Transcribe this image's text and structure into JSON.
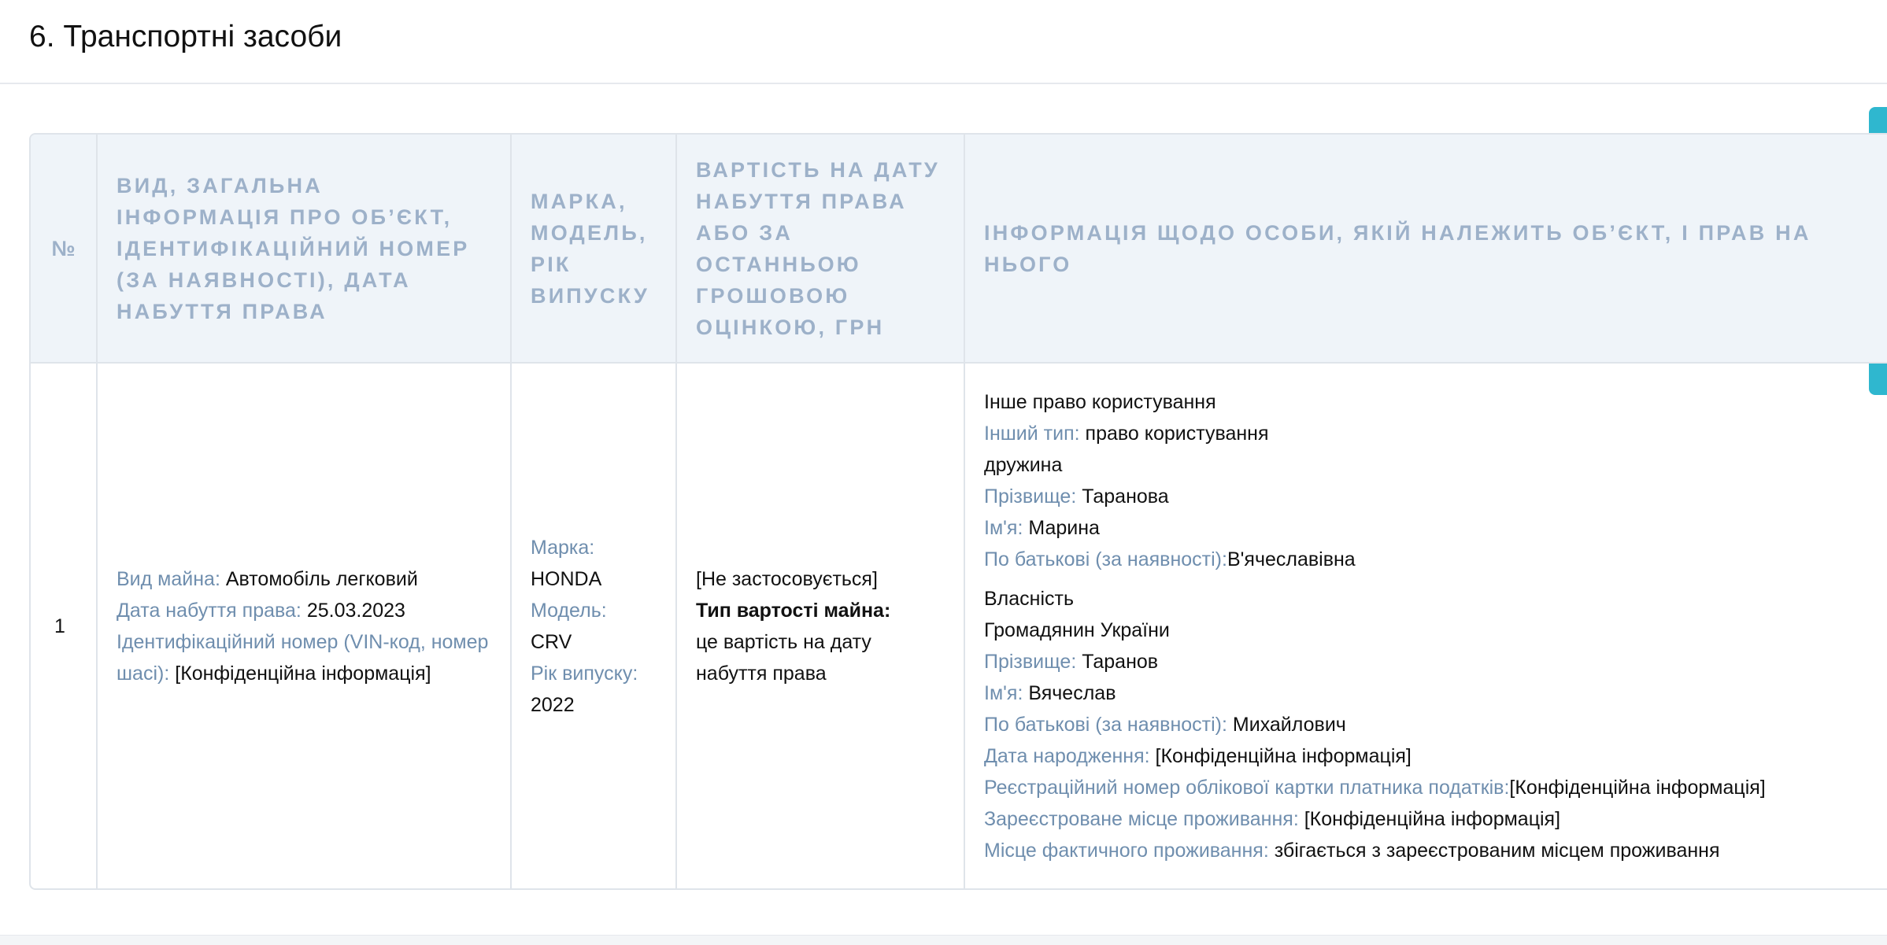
{
  "section": {
    "title": "6. Транспортні засоби"
  },
  "table": {
    "headers": {
      "num": "№",
      "info": "Вид, загальна інформація про об’єкт, ідентифікаційний номер (за наявності), дата набуття права",
      "brand": "Марка, модель, рік випуску",
      "value": "Вартість на дату набуття права або за останньою грошовою оцінкою, грн",
      "owner": "Інформація щодо особи, якій належить об’єкт, і прав на нього"
    },
    "row": {
      "num": "1",
      "info": {
        "kind_label": "Вид майна:",
        "kind_value": " Автомобіль легковий",
        "date_label": "Дата набуття права:",
        "date_value": " 25.03.2023",
        "vin_label": "Ідентифікаційний номер (VIN-код, номер шасі):",
        "vin_value": " [Конфіденційна інформація]"
      },
      "brand": {
        "make_label": "Марка:",
        "make_value": "HONDA",
        "model_label": "Модель:",
        "model_value": "CRV",
        "year_label": "Рік випуску:",
        "year_value": "2022"
      },
      "value": {
        "amount": "[Не застосовується]",
        "type_label": "Тип вартості майна:",
        "type_value": "це вартість на дату набуття права"
      },
      "owner": {
        "right1": {
          "right_type": "Інше право користування",
          "other_type_label": "Інший тип:",
          "other_type_value": " право користування",
          "relation": "дружина",
          "surname_label": "Прізвище:",
          "surname_value": " Таранова",
          "name_label": "Ім'я:",
          "name_value": " Марина",
          "patronymic_label": "По батькові (за наявності):",
          "patronymic_value": "В'ячеславівна"
        },
        "right2": {
          "right_type": "Власність",
          "citizenship": "Громадянин України",
          "surname_label": "Прізвище:",
          "surname_value": " Таранов",
          "name_label": "Ім'я:",
          "name_value": " Вячеслав",
          "patronymic_label": "По батькові (за наявності):",
          "patronymic_value": " Михайлович",
          "birth_label": "Дата народження:",
          "birth_value": " [Конфіденційна інформація]",
          "tax_label": "Реєстраційний номер облікової картки платника податків:",
          "tax_value": "[Конфіденційна інформація]",
          "reg_label": "Зареєстроване місце проживання:",
          "reg_value": " [Конфіденційна інформація]",
          "actual_label": "Місце фактичного проживання:",
          "actual_value": " збігається з зареєстрованим місцем проживання"
        }
      }
    }
  },
  "colors": {
    "label": "#6f8eae",
    "header_text": "#9db1c9",
    "header_bg": "#eff4f9",
    "accent_tab": "#2fb7cf"
  }
}
